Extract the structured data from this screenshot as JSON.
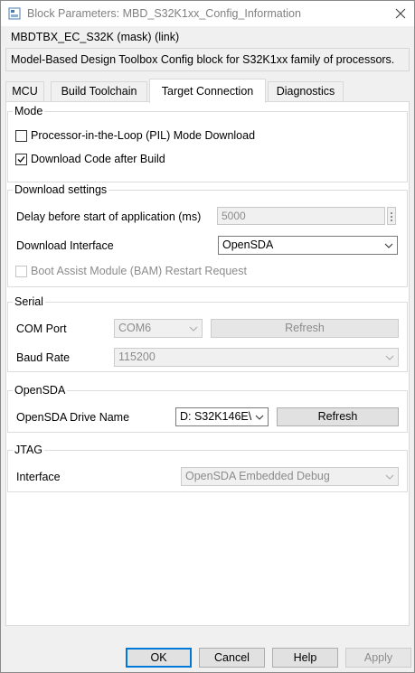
{
  "window": {
    "title": "Block Parameters: MBD_S32K1xx_Config_Information"
  },
  "header": {
    "mask_line": "MBDTBX_EC_S32K (mask) (link)",
    "description": "Model-Based Design Toolbox Config block for S32K1xx family of processors."
  },
  "tabs": [
    {
      "label": "MCU",
      "active": false
    },
    {
      "label": "Build Toolchain",
      "active": false
    },
    {
      "label": "Target Connection",
      "active": true
    },
    {
      "label": "Diagnostics",
      "active": false
    }
  ],
  "mode": {
    "label": "Mode",
    "pil": {
      "label": "Processor-in-the-Loop (PIL) Mode Download",
      "checked": false
    },
    "download_after_build": {
      "label": "Download Code after Build",
      "checked": true
    }
  },
  "download_settings": {
    "label": "Download settings",
    "delay": {
      "label": "Delay before start of application (ms)",
      "value": "5000"
    },
    "interface": {
      "label": "Download Interface",
      "value": "OpenSDA"
    },
    "bam": {
      "label": "Boot Assist Module (BAM) Restart Request",
      "checked": false
    }
  },
  "serial": {
    "label": "Serial",
    "com_port": {
      "label": "COM Port",
      "value": "COM6"
    },
    "refresh_label": "Refresh",
    "baud_rate": {
      "label": "Baud Rate",
      "value": "115200"
    }
  },
  "opensda": {
    "label": "OpenSDA",
    "drive": {
      "label": "OpenSDA Drive Name",
      "value": "D: S32K146E\\"
    },
    "refresh_label": "Refresh"
  },
  "jtag": {
    "label": "JTAG",
    "interface": {
      "label": "Interface",
      "value": "OpenSDA Embedded Debug"
    }
  },
  "footer": {
    "ok": "OK",
    "cancel": "Cancel",
    "help": "Help",
    "apply": "Apply"
  },
  "colors": {
    "accent": "#0078d7",
    "disabled_text": "#8c8c8c"
  }
}
